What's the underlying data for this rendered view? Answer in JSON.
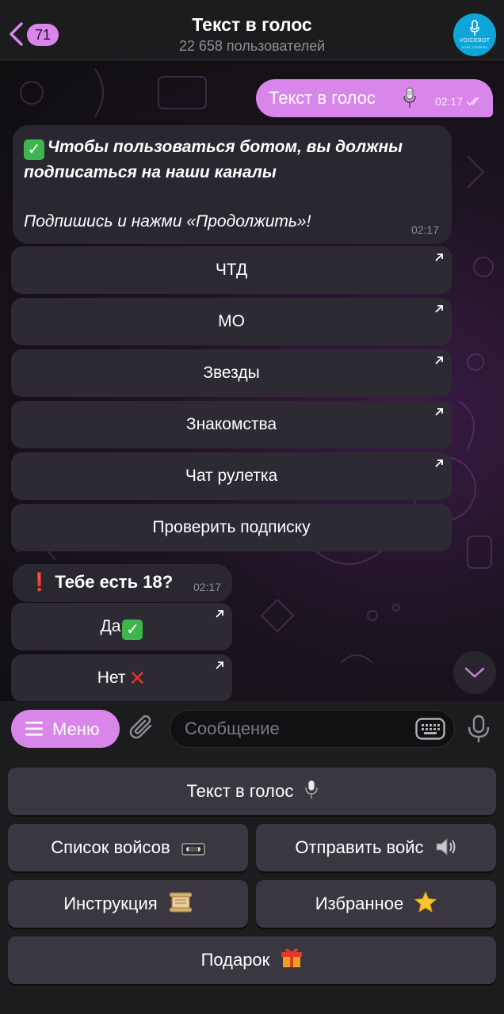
{
  "header": {
    "unread_count": "71",
    "title": "Текст в голос",
    "subtitle": "22 658 пользователей",
    "avatar_brand": "VOICEBOT",
    "avatar_tagline": "ВОЙС СТИКЕРЫ"
  },
  "chat": {
    "outgoing": {
      "text": "Текст в голос",
      "icon": "microphone-icon",
      "time": "02:17"
    },
    "subscribe_message": {
      "line1": "Чтобы пользоваться ботом, вы должны",
      "line2": "подписаться на наши каналы",
      "line3": "Подпишись и нажми «Продолжить»!",
      "time": "02:17"
    },
    "channel_buttons": [
      "ЧТД",
      "МО",
      "Звезды",
      "Знакомства",
      "Чат рулетка"
    ],
    "check_button": "Проверить подписку",
    "age_message": {
      "mark": "❗",
      "text": "Тебе есть 18?",
      "time": "02:17"
    },
    "age_buttons": {
      "yes": "Да",
      "no": "Нет"
    }
  },
  "input_bar": {
    "menu_label": "Меню",
    "placeholder": "Сообщение"
  },
  "reply_keyboard": {
    "text_to_voice": "Текст в голос",
    "voice_list": "Список войсов",
    "send_voice": "Отправить войс",
    "instruction": "Инструкция",
    "favorites": "Избранное",
    "gift": "Подарок"
  },
  "colors": {
    "accent": "#d886ea",
    "bubble_in": "#2a2730",
    "header_bg": "#1c1c1e",
    "avatar_bg": "#0ea6d8"
  }
}
